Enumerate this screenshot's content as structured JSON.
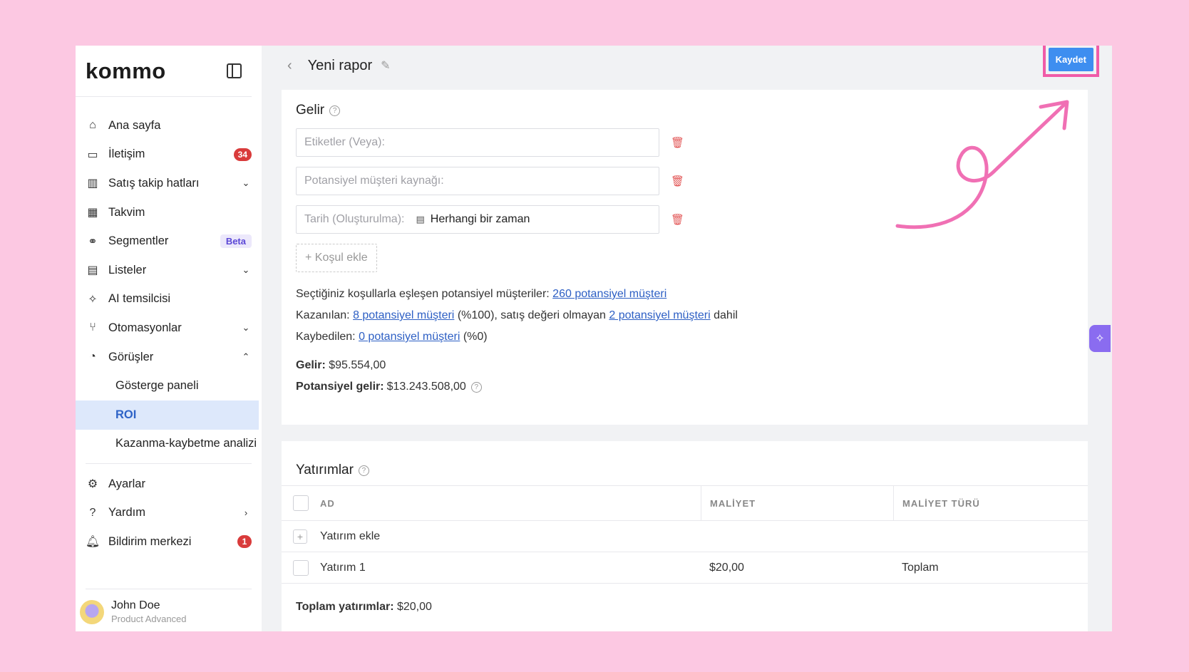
{
  "brand": {
    "logo": "kommo"
  },
  "sidebar": {
    "items": [
      {
        "label": "Ana sayfa"
      },
      {
        "label": "İletişim",
        "badge": "34"
      },
      {
        "label": "Satış takip hatları"
      },
      {
        "label": "Takvim"
      },
      {
        "label": "Segmentler",
        "badge": "Beta"
      },
      {
        "label": "Listeler"
      },
      {
        "label": "AI temsilcisi"
      },
      {
        "label": "Otomasyonlar"
      },
      {
        "label": "Görüşler"
      }
    ],
    "sub_items": [
      {
        "label": "Gösterge paneli"
      },
      {
        "label": "ROI"
      },
      {
        "label": "Kazanma-kaybetme analizi"
      }
    ],
    "bottom_items": [
      {
        "label": "Ayarlar"
      },
      {
        "label": "Yardım"
      },
      {
        "label": "Bildirim merkezi",
        "badge": "1"
      }
    ],
    "user": {
      "name": "John Doe",
      "plan": "Product Advanced"
    }
  },
  "header": {
    "title": "Yeni rapor",
    "save_label": "Kaydet"
  },
  "revenue": {
    "title": "Gelir",
    "conditions": [
      {
        "placeholder": "Etiketler (Veya):"
      },
      {
        "placeholder": "Potansiyel müşteri kaynağı:"
      },
      {
        "placeholder": "Tarih (Oluşturulma):",
        "value": "Herhangi bir zaman"
      }
    ],
    "add_condition": "+ Koşul ekle",
    "matched_prefix": "Seçtiğiniz koşullarla eşleşen potansiyel müşteriler:",
    "matched_link": "260 potansiyel müşteri",
    "won_prefix": "Kazanılan:",
    "won_link": "8 potansiyel müşteri",
    "won_middle": "(%100), satış değeri olmayan",
    "won_link2": "2 potansiyel müşteri",
    "won_suffix": "dahil",
    "lost_prefix": "Kaybedilen:",
    "lost_link": "0 potansiyel müşteri",
    "lost_suffix": "(%0)",
    "revenue_label": "Gelir:",
    "revenue_value": "$95.554,00",
    "potential_label": "Potansiyel gelir:",
    "potential_value": "$13.243.508,00"
  },
  "investments": {
    "title": "Yatırımlar",
    "columns": [
      "AD",
      "MALİYET",
      "MALİYET TÜRÜ"
    ],
    "add_label": "Yatırım ekle",
    "rows": [
      {
        "name": "Yatırım 1",
        "cost": "$20,00",
        "type": "Toplam"
      }
    ],
    "total_label": "Toplam yatırımlar:",
    "total_value": "$20,00"
  },
  "colors": {
    "accent": "#3e8ef0",
    "highlight": "#f05ca8",
    "badge": "#d93b3b",
    "active_bg": "#dde8fb"
  }
}
